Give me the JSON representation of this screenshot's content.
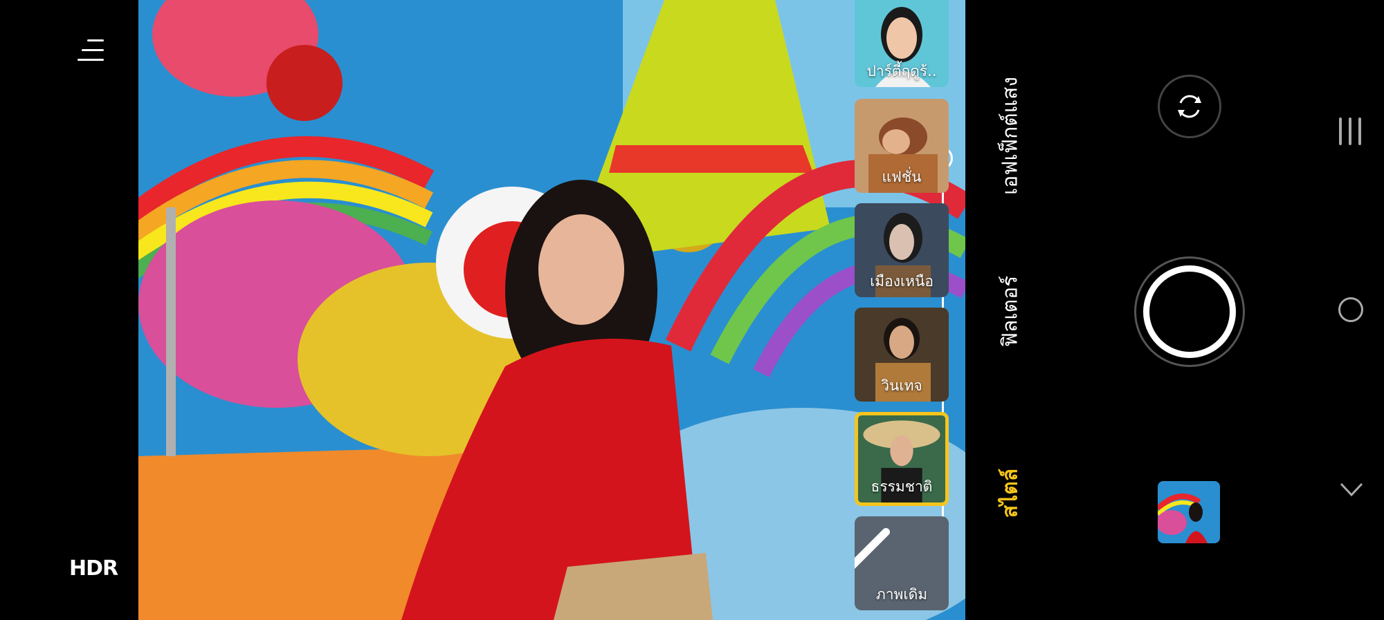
{
  "left_controls": {
    "menu_icon": "hamburger-menu-icon",
    "hdr_label": "HDR"
  },
  "style_filters": [
    {
      "label": "ปาร์ตี้ฤดูร้..",
      "selected": false
    },
    {
      "label": "แฟชั่น",
      "selected": false
    },
    {
      "label": "เมืองเหนือ",
      "selected": false
    },
    {
      "label": "วินเทจ",
      "selected": false
    },
    {
      "label": "ธรรมชาติ",
      "selected": true
    },
    {
      "label": "ภาพเดิม",
      "selected": false
    }
  ],
  "modes": {
    "light_effects": "เอฟเฟ็กต์แสง",
    "filters": "ฟิลเตอร์",
    "style": "สไตล์"
  },
  "colors": {
    "accent": "#f6c51b",
    "active_mode": "#f6c51b",
    "inactive_mode": "#ffffff"
  },
  "icons": {
    "switch_camera": "rotate-camera-icon",
    "shutter": "shutter-icon",
    "nav_recents": "recents-icon",
    "nav_home": "home-icon",
    "nav_back": "chevron-down-icon"
  }
}
